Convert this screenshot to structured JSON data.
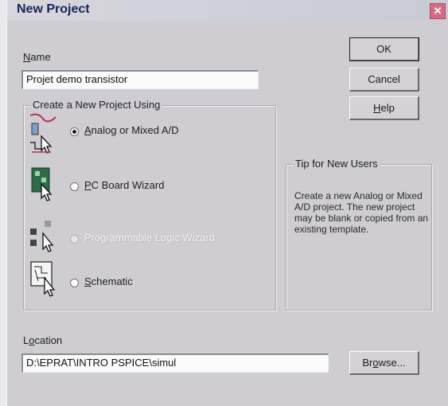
{
  "dialog": {
    "title": "New Project"
  },
  "name_field": {
    "label_mnemonic": "N",
    "label_rest": "ame",
    "value": "Projet demo transistor"
  },
  "buttons": {
    "ok": "OK",
    "cancel": "Cancel",
    "help_mnemonic": "H",
    "help_rest": "elp",
    "browse_pre": "Br",
    "browse_mnemonic": "o",
    "browse_post": "wse..."
  },
  "create_group": {
    "title": "Create a New Project Using",
    "options": [
      {
        "pre": "",
        "mnemonic": "A",
        "post": "nalog or Mixed A/D",
        "selected": true,
        "enabled": true,
        "icon": "analog-circuit-icon"
      },
      {
        "pre": "",
        "mnemonic": "P",
        "post": "C Board Wizard",
        "selected": false,
        "enabled": true,
        "icon": "pcb-wizard-icon"
      },
      {
        "pre": "Programmable Logic Wizard",
        "mnemonic": "",
        "post": "",
        "selected": false,
        "enabled": false,
        "icon": "programmable-logic-icon"
      },
      {
        "pre": "",
        "mnemonic": "S",
        "post": "chematic",
        "selected": false,
        "enabled": true,
        "icon": "schematic-icon"
      }
    ]
  },
  "tip_group": {
    "title": "Tip for New Users",
    "text": "Create a new Analog or Mixed A/D project.  The new project may be blank or copied from an existing template."
  },
  "location_field": {
    "label_pre": "L",
    "label_mnemonic": "o",
    "label_post": "cation",
    "value": "D:\\EPRAT\\INTRO PSPICE\\simul"
  }
}
